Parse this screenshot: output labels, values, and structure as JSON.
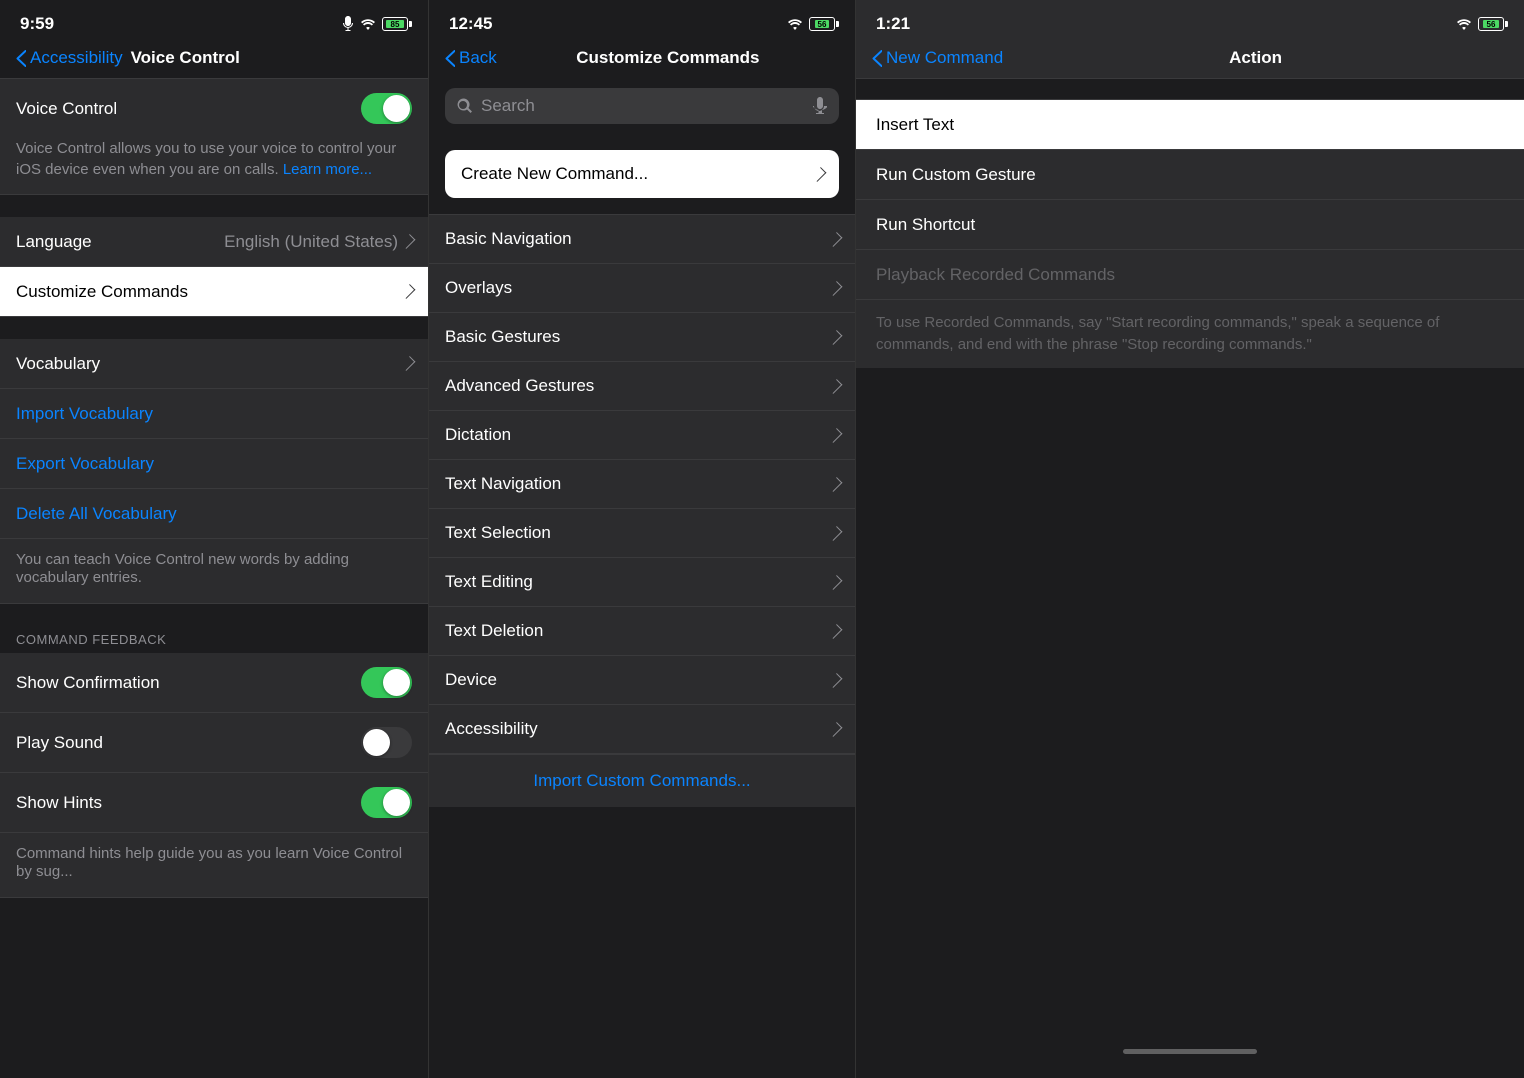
{
  "screen1": {
    "status": {
      "time": "9:59",
      "mic": true
    },
    "nav": {
      "back_label": "Accessibility",
      "title": "Voice Control"
    },
    "voice_control": {
      "label": "Voice Control",
      "description": "Voice Control allows you to use your voice to control your iOS device even when you are on calls.",
      "learn_more": "Learn more...",
      "toggle": true
    },
    "language_row": {
      "label": "Language",
      "value": "English (United States)"
    },
    "customize_row": {
      "label": "Customize Commands"
    },
    "vocabulary_row": {
      "label": "Vocabulary"
    },
    "import_vocab": "Import Vocabulary",
    "export_vocab": "Export Vocabulary",
    "delete_vocab": "Delete All Vocabulary",
    "vocab_hint": "You can teach Voice Control new words by adding vocabulary entries.",
    "section_feedback": "COMMAND FEEDBACK",
    "show_confirmation": {
      "label": "Show Confirmation",
      "toggle": true
    },
    "play_sound": {
      "label": "Play Sound",
      "toggle": false
    },
    "show_hints": {
      "label": "Show Hints",
      "toggle": true
    },
    "hints_desc": "Command hints help guide you as you learn Voice Control by sug..."
  },
  "screen2": {
    "status": {
      "time": "12:45"
    },
    "nav": {
      "back_label": "Back",
      "title": "Customize Commands"
    },
    "search_placeholder": "Search",
    "create_new": "Create New Command...",
    "commands": [
      {
        "label": "Basic Navigation"
      },
      {
        "label": "Overlays"
      },
      {
        "label": "Basic Gestures"
      },
      {
        "label": "Advanced Gestures"
      },
      {
        "label": "Dictation"
      },
      {
        "label": "Text Navigation"
      },
      {
        "label": "Text Selection"
      },
      {
        "label": "Text Editing"
      },
      {
        "label": "Text Deletion"
      },
      {
        "label": "Device"
      },
      {
        "label": "Accessibility"
      }
    ],
    "import_link": "Import Custom Commands..."
  },
  "screen3": {
    "status": {
      "time": "1:21"
    },
    "nav": {
      "back_label": "New Command",
      "title": "Action"
    },
    "actions": [
      {
        "label": "Insert Text",
        "selected": true,
        "disabled": false
      },
      {
        "label": "Run Custom Gesture",
        "selected": false,
        "disabled": false
      },
      {
        "label": "Run Shortcut",
        "selected": false,
        "disabled": false
      },
      {
        "label": "Playback Recorded Commands",
        "selected": false,
        "disabled": true
      }
    ],
    "playback_description": "To use Recorded Commands, say \"Start recording commands,\" speak a sequence of commands, and end with the phrase \"Stop recording commands.\""
  }
}
